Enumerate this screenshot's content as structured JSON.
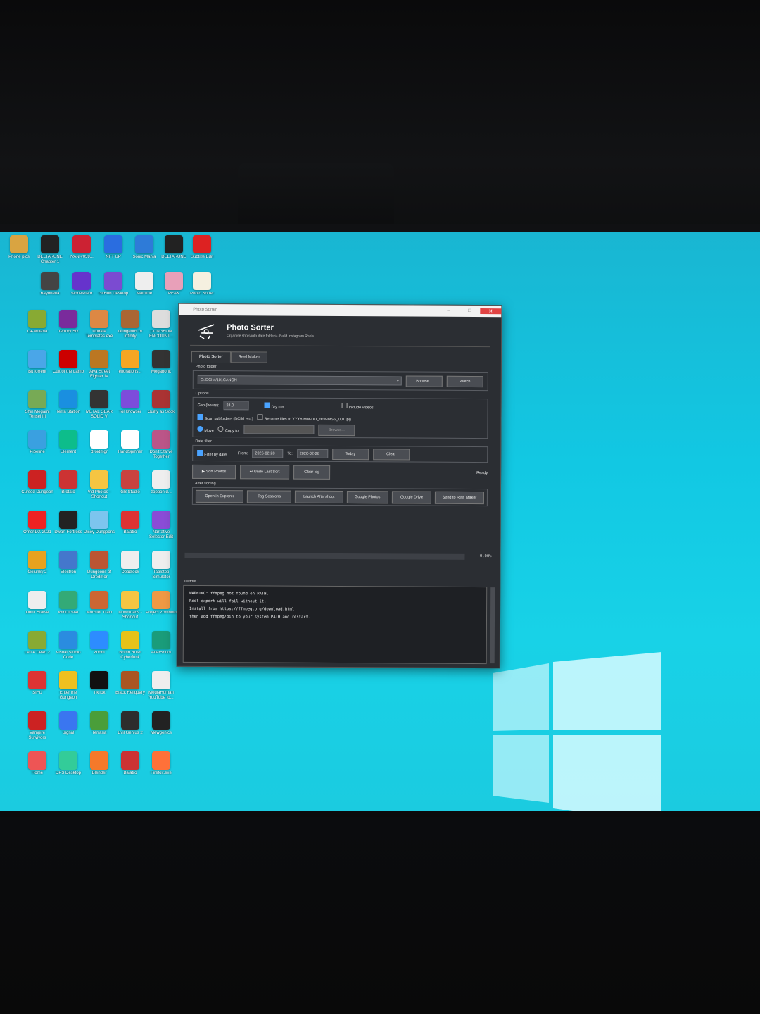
{
  "desktop": {
    "icons": [
      {
        "label": "Phone pics",
        "color": "#d9a441"
      },
      {
        "label": "DELTARUNE Chapter 1",
        "color": "#222"
      },
      {
        "label": "IVAN-v059...",
        "color": "#c23"
      },
      {
        "label": "NFT UP",
        "color": "#2a6de0"
      },
      {
        "label": "Sonic Mania",
        "color": "#2e7bd8"
      },
      {
        "label": "DELTARUNE",
        "color": "#222"
      },
      {
        "label": "Subtitle Edit",
        "color": "#d22"
      },
      {
        "label": "Bayonetta",
        "color": "#444"
      },
      {
        "label": "Stoneshard",
        "color": "#63c"
      },
      {
        "label": "GitHub Desktop",
        "color": "#7b4bd1"
      },
      {
        "label": "Mainline",
        "color": "#eee"
      },
      {
        "label": "PEAK",
        "color": "#e8a0b9"
      },
      {
        "label": "Photo Sorter",
        "color": "#f5f0e0"
      },
      {
        "label": "La-Mulana",
        "color": "#8a3"
      },
      {
        "label": "Terrory Six",
        "color": "#7a2b9c"
      },
      {
        "label": "Update Templates.exe",
        "color": "#d84"
      },
      {
        "label": "Dungeons of Infinity",
        "color": "#a63"
      },
      {
        "label": "DUNGEON ENCOUNT...",
        "color": "#ddd"
      },
      {
        "label": "BitTorrent",
        "color": "#4aa6e8"
      },
      {
        "label": "Cult of the Lamb",
        "color": "#c00"
      },
      {
        "label": "Java Street Fighter IV",
        "color": "#b72"
      },
      {
        "label": "eflorations...",
        "color": "#f5a623"
      },
      {
        "label": "Megabonk",
        "color": "#333"
      },
      {
        "label": "Shin Megami Tensei III",
        "color": "#7a5"
      },
      {
        "label": "Terra Station",
        "color": "#1a8fe0"
      },
      {
        "label": "METAL GEAR SOLID V",
        "color": "#333"
      },
      {
        "label": "Tor Browser",
        "color": "#7d4cdb"
      },
      {
        "label": "Guilty as Sock",
        "color": "#a33"
      },
      {
        "label": "Pipeline",
        "color": "#3aa0e0"
      },
      {
        "label": "Element",
        "color": "#0dbd8b"
      },
      {
        "label": "droidmgr",
        "color": "#fff"
      },
      {
        "label": "HandSpinner",
        "color": "#fff"
      },
      {
        "label": "Don't Starve Together",
        "color": "#b58"
      },
      {
        "label": "Cursed Dungeon",
        "color": "#c22"
      },
      {
        "label": "Brotato",
        "color": "#c33"
      },
      {
        "label": "Vid Photos - Shortcut",
        "color": "#f5c542"
      },
      {
        "label": "GB Studio",
        "color": "#c9423f"
      },
      {
        "label": "zoppon.d...",
        "color": "#eee"
      },
      {
        "label": "OmoriDX 2021",
        "color": "#e22"
      },
      {
        "label": "Dwarf Fortress",
        "color": "#222"
      },
      {
        "label": "Dicey Dungeons",
        "color": "#7cc5ee"
      },
      {
        "label": "Balatro",
        "color": "#d33"
      },
      {
        "label": "Narrative Selector Edit",
        "color": "#8a4cd6"
      },
      {
        "label": "Gelunky 2",
        "color": "#e8a21e"
      },
      {
        "label": "Electron",
        "color": "#47c"
      },
      {
        "label": "Dungeons of Dredmor",
        "color": "#b53"
      },
      {
        "label": "Deadlock",
        "color": "#eee"
      },
      {
        "label": "Tabletop Simulator",
        "color": "#eee"
      },
      {
        "label": "Don't Starve",
        "color": "#eee"
      },
      {
        "label": "WinDirStat",
        "color": "#3a7"
      },
      {
        "label": "Monster Train",
        "color": "#c63"
      },
      {
        "label": "Downloads - Shortcut",
        "color": "#f5c542"
      },
      {
        "label": "Project Zomboid",
        "color": "#e94"
      },
      {
        "label": "Left 4 Dead 2",
        "color": "#8a3"
      },
      {
        "label": "Visual Studio Code",
        "color": "#2a8ce0"
      },
      {
        "label": "Zoom",
        "color": "#2d8cff"
      },
      {
        "label": "Bomb Rush Cyberfunk",
        "color": "#e5c21a"
      },
      {
        "label": "AfterShoot",
        "color": "#1a9c7a"
      },
      {
        "label": "SIFU",
        "color": "#d33"
      },
      {
        "label": "Enter the Gungeon",
        "color": "#f0c020"
      },
      {
        "label": "TikTok",
        "color": "#111"
      },
      {
        "label": "Black Reliquary",
        "color": "#a52"
      },
      {
        "label": "MediaHuman YouTube to...",
        "color": "#eee"
      },
      {
        "label": "Vampire Survivors",
        "color": "#c22"
      },
      {
        "label": "Signal",
        "color": "#3a76f0"
      },
      {
        "label": "Terraria",
        "color": "#4a9e3a"
      },
      {
        "label": "Evil Genius 2",
        "color": "#2d2d2d"
      },
      {
        "label": "Mewgenics",
        "color": "#222"
      },
      {
        "label": "Home",
        "color": "#e55"
      },
      {
        "label": "DPS Desktop",
        "color": "#3c9"
      },
      {
        "label": "Blender",
        "color": "#f5792a"
      },
      {
        "label": "Balatro",
        "color": "#c33"
      },
      {
        "label": "Firefox.exe",
        "color": "#ff7139"
      }
    ]
  },
  "taskbar": {
    "items": [
      {
        "icon": "windows-icon",
        "color": "#1a7fd4"
      },
      {
        "icon": "terminal-icon",
        "color": "#3a8de0"
      },
      {
        "icon": "chrome-icon",
        "color": "#f4c20d"
      },
      {
        "icon": "vscode-icon",
        "color": "#2a8ce0"
      },
      {
        "icon": "app-icon",
        "color": "#c0397a"
      },
      {
        "icon": "steam-icon",
        "color": "#e6e6e6"
      },
      {
        "icon": "banana-icon",
        "color": "#f5d142"
      },
      {
        "icon": "app-icon",
        "color": "#3a8de0"
      },
      {
        "icon": "app-icon",
        "color": "#eee"
      },
      {
        "icon": "firefox-icon",
        "color": "#ff7139"
      },
      {
        "icon": "obs-icon",
        "color": "#ccc"
      },
      {
        "icon": "app-icon",
        "color": "#e94"
      },
      {
        "icon": "app-icon",
        "color": "#a6c"
      },
      {
        "icon": "app-icon",
        "color": "#d22"
      },
      {
        "icon": "app-icon",
        "color": "#eee"
      },
      {
        "icon": "app-icon",
        "color": "#f5f5f5"
      },
      {
        "icon": "photo-sorter-icon",
        "color": "#f5f0e0"
      }
    ]
  },
  "app": {
    "window_title": "Photo Sorter",
    "title": "Photo Sorter",
    "subtitle": "Organise shots into date folders  ·  Build Instagram Reels",
    "tabs": [
      "Photo Sorter",
      "Reel Maker"
    ],
    "photo_folder_label": "Photo folder",
    "photo_folder_value": "G:/DCIM/101CANON",
    "browse_label": "Browse...",
    "watch_label": "Watch",
    "options_label": "Options",
    "gap_label": "Gap (hours):",
    "gap_value": "24.0",
    "dry_run_label": "Dry run",
    "include_videos_label": "Include videos",
    "scan_subfolders_label": "Scan subfolders (DCIM etc.)",
    "rename_label": "Rename files to YYYY-MM-DD_HHMMSS_001.jpg",
    "move_label": "Move",
    "copy_to_label": "Copy to:",
    "copy_browse_label": "Browse...",
    "date_filter_label": "Date filter",
    "filter_by_date_label": "Filter by date",
    "from_label": "From:",
    "from_value": "2026-02-28",
    "to_label": "To:",
    "to_value": "2026-02-28",
    "today_label": "Today",
    "clear_label": "Clear",
    "sort_photos_label": "▶  Sort Photos",
    "undo_label": "↩  Undo Last Sort",
    "clear_log_label": "Clear log",
    "status_text": "Ready",
    "after_sorting_label": "After sorting",
    "after_buttons": [
      "Open in Explorer",
      "Tag Sessions",
      "Launch Aftershoot",
      "Google Photos",
      "Google Drive",
      "Send to Reel Maker"
    ],
    "progress_percent": "0.00%",
    "progress_value": 0,
    "output_label": "Output",
    "output_lines": [
      "WARNING: ffmpeg not found on PATH.",
      "Reel export will fail without it.",
      "Install from https://ffmpeg.org/download.html",
      "then add ffmpeg/bin to your system PATH and restart."
    ]
  }
}
